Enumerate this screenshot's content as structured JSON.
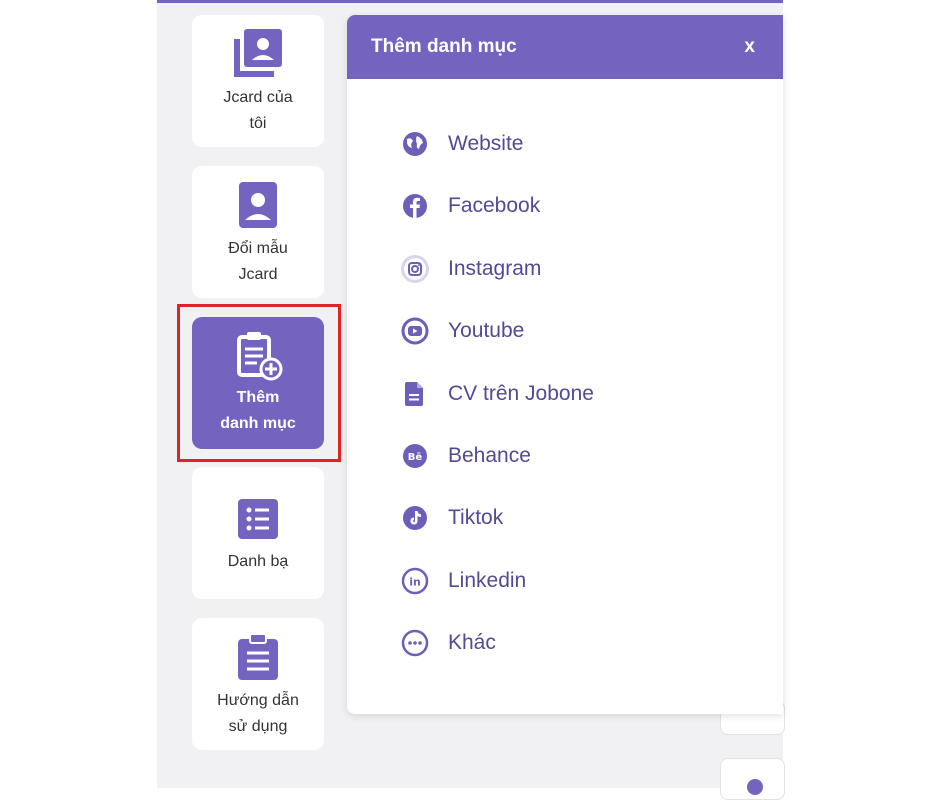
{
  "sidebar": {
    "items": [
      {
        "label": "Jcard của tôi",
        "line1": "Jcard của",
        "line2": "tôi",
        "icon": "portrait-stack-icon"
      },
      {
        "label": "Đổi mẫu Jcard",
        "line1": "Đổi mẫu",
        "line2": "Jcard",
        "icon": "portrait-icon"
      },
      {
        "label": "Thêm danh mục",
        "line1": "Thêm",
        "line2": "danh mục",
        "icon": "clipboard-add-icon",
        "active": true
      },
      {
        "label": "Danh bạ",
        "line1": "Danh bạ",
        "icon": "list-icon"
      },
      {
        "label": "Hướng dẫn sử dụng",
        "line1": "Hướng dẫn",
        "line2": "sử dụng",
        "icon": "clipboard-text-icon"
      }
    ]
  },
  "panel": {
    "title": "Thêm danh mục",
    "close_label": "x",
    "items": [
      {
        "label": "Website",
        "icon": "globe-icon"
      },
      {
        "label": "Facebook",
        "icon": "facebook-icon"
      },
      {
        "label": "Instagram",
        "icon": "instagram-icon"
      },
      {
        "label": "Youtube",
        "icon": "youtube-icon"
      },
      {
        "label": "CV trên Jobone",
        "icon": "document-icon"
      },
      {
        "label": "Behance",
        "icon": "behance-icon"
      },
      {
        "label": "Tiktok",
        "icon": "tiktok-icon"
      },
      {
        "label": "Linkedin",
        "icon": "linkedin-icon"
      },
      {
        "label": "Khác",
        "icon": "more-icon"
      }
    ]
  },
  "colors": {
    "accent": "#7464c0",
    "highlight": "#e02424",
    "menu_text": "#534a94",
    "background": "#f1f1f3"
  }
}
